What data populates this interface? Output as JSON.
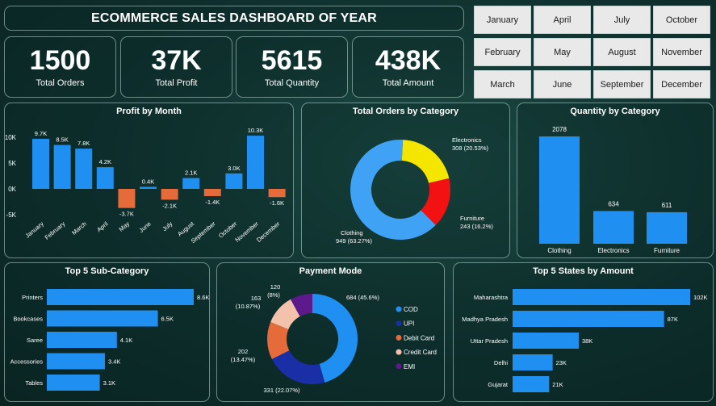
{
  "dashboard_title": "ECOMMERCE SALES DASHBOARD OF YEAR",
  "kpis": [
    {
      "value": "1500",
      "label": "Total Orders"
    },
    {
      "value": "37K",
      "label": "Total Profit"
    },
    {
      "value": "5615",
      "label": "Total Quantity"
    },
    {
      "value": "438K",
      "label": "Total Amount"
    }
  ],
  "months": [
    "January",
    "April",
    "July",
    "October",
    "February",
    "May",
    "August",
    "November",
    "March",
    "June",
    "September",
    "December"
  ],
  "colors": {
    "blue": "#1f8ff2",
    "orange": "#e56b3a",
    "yellow": "#f5e600",
    "red": "#f21212",
    "light_blue": "#3fa2f5",
    "navy": "#1a2ea6",
    "peach": "#f2c3aa",
    "purple": "#5e1a8a",
    "cod": "#1f8ff2"
  },
  "chart_data": [
    {
      "title": "Profit by Month",
      "type": "bar",
      "categories": [
        "January",
        "February",
        "March",
        "April",
        "May",
        "June",
        "July",
        "August",
        "September",
        "October",
        "November",
        "December"
      ],
      "values": [
        9.7,
        8.5,
        7.8,
        4.2,
        -3.7,
        0.4,
        -2.1,
        2.1,
        -1.4,
        3.0,
        10.3,
        -1.6
      ],
      "labels": [
        "9.7K",
        "8.5K",
        "7.8K",
        "4.2K",
        "-3.7K",
        "0.4K",
        "-2.1K",
        "2.1K",
        "-1.4K",
        "3.0K",
        "10.3K",
        "-1.6K"
      ],
      "yticks": [
        "10K",
        "5K",
        "0K",
        "-5K"
      ],
      "ylim": [
        -5,
        10
      ]
    },
    {
      "title": "Total Orders by Category",
      "type": "pie",
      "slices": [
        {
          "name": "Clothing",
          "value": 949,
          "label_name": "Clothing",
          "label_value": "949 (63.27%)"
        },
        {
          "name": "Electronics",
          "value": 308,
          "label_name": "Electronics",
          "label_value": "308 (20.53%)"
        },
        {
          "name": "Furniture",
          "value": 243,
          "label_name": "Furniture",
          "label_value": "243 (16.2%)"
        }
      ]
    },
    {
      "title": "Quantity by Category",
      "type": "bar",
      "categories": [
        "Clothing",
        "Electronics",
        "Furniture"
      ],
      "values": [
        2078,
        634,
        611
      ]
    },
    {
      "title": "Top 5 Sub-Category",
      "type": "bar",
      "orientation": "horizontal",
      "categories": [
        "Printers",
        "Bookcases",
        "Saree",
        "Accessories",
        "Tables"
      ],
      "values": [
        8.6,
        6.5,
        4.1,
        3.4,
        3.1
      ],
      "labels": [
        "8.6K",
        "6.5K",
        "4.1K",
        "3.4K",
        "3.1K"
      ]
    },
    {
      "title": "Payment Mode",
      "type": "pie",
      "slices": [
        {
          "name": "COD",
          "value": 684,
          "label": "684 (45.6%)"
        },
        {
          "name": "UPI",
          "value": 331,
          "label": "331 (22.07%)"
        },
        {
          "name": "Debit Card",
          "value": 202,
          "label": "202 (13.47%)"
        },
        {
          "name": "Credit Card",
          "value": 163,
          "label": "163 (10.87%)"
        },
        {
          "name": "EMI",
          "value": 120,
          "label": "120 (8%)"
        }
      ],
      "label_lines": {
        "debit_1": "202",
        "debit_2": "(13.47%)",
        "credit_1": "163",
        "credit_2": "(10.87%)",
        "emi_1": "120",
        "emi_2": "(8%)"
      }
    },
    {
      "title": "Top 5 States by Amount",
      "type": "bar",
      "orientation": "horizontal",
      "categories": [
        "Maharashtra",
        "Madhya Pradesh",
        "Uttar Pradesh",
        "Delhi",
        "Gujarat"
      ],
      "values": [
        102,
        87,
        38,
        23,
        21
      ],
      "labels": [
        "102K",
        "87K",
        "38K",
        "23K",
        "21K"
      ]
    }
  ]
}
